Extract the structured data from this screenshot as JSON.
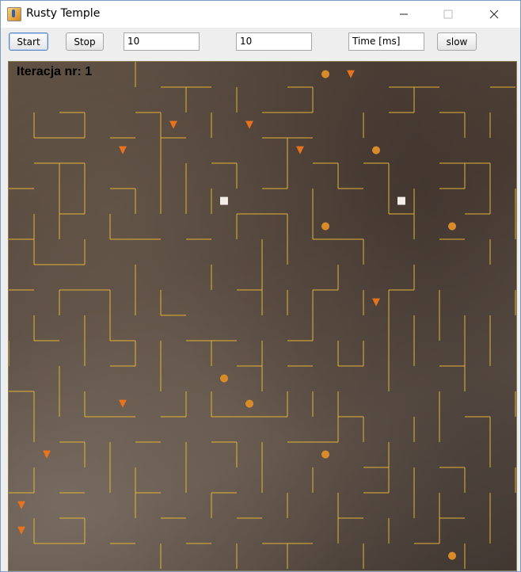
{
  "window": {
    "title": "Rusty Temple"
  },
  "toolbar": {
    "start_label": "Start",
    "stop_label": "Stop",
    "field1_value": "10",
    "field2_value": "10",
    "time_placeholder": "Time [ms]",
    "slow_label": "slow"
  },
  "board": {
    "iteration_label": "Iteracja nr: 1",
    "wall_color": "#e3b23c",
    "foxes": [
      {
        "col": 13,
        "row": 0
      },
      {
        "col": 6,
        "row": 2
      },
      {
        "col": 9,
        "row": 2
      },
      {
        "col": 4,
        "row": 3
      },
      {
        "col": 11,
        "row": 3
      },
      {
        "col": 14,
        "row": 9
      },
      {
        "col": 4,
        "row": 13
      },
      {
        "col": 1,
        "row": 15
      },
      {
        "col": 0,
        "row": 17
      },
      {
        "col": 0,
        "row": 18
      }
    ],
    "acorns": [
      {
        "col": 12,
        "row": 0
      },
      {
        "col": 14,
        "row": 3
      },
      {
        "col": 12,
        "row": 6
      },
      {
        "col": 17,
        "row": 6
      },
      {
        "col": 8,
        "row": 12
      },
      {
        "col": 9,
        "row": 13
      },
      {
        "col": 12,
        "row": 15
      },
      {
        "col": 17,
        "row": 19
      }
    ],
    "ghosts": [
      {
        "col": 8,
        "row": 5
      },
      {
        "col": 15,
        "row": 5
      }
    ]
  }
}
